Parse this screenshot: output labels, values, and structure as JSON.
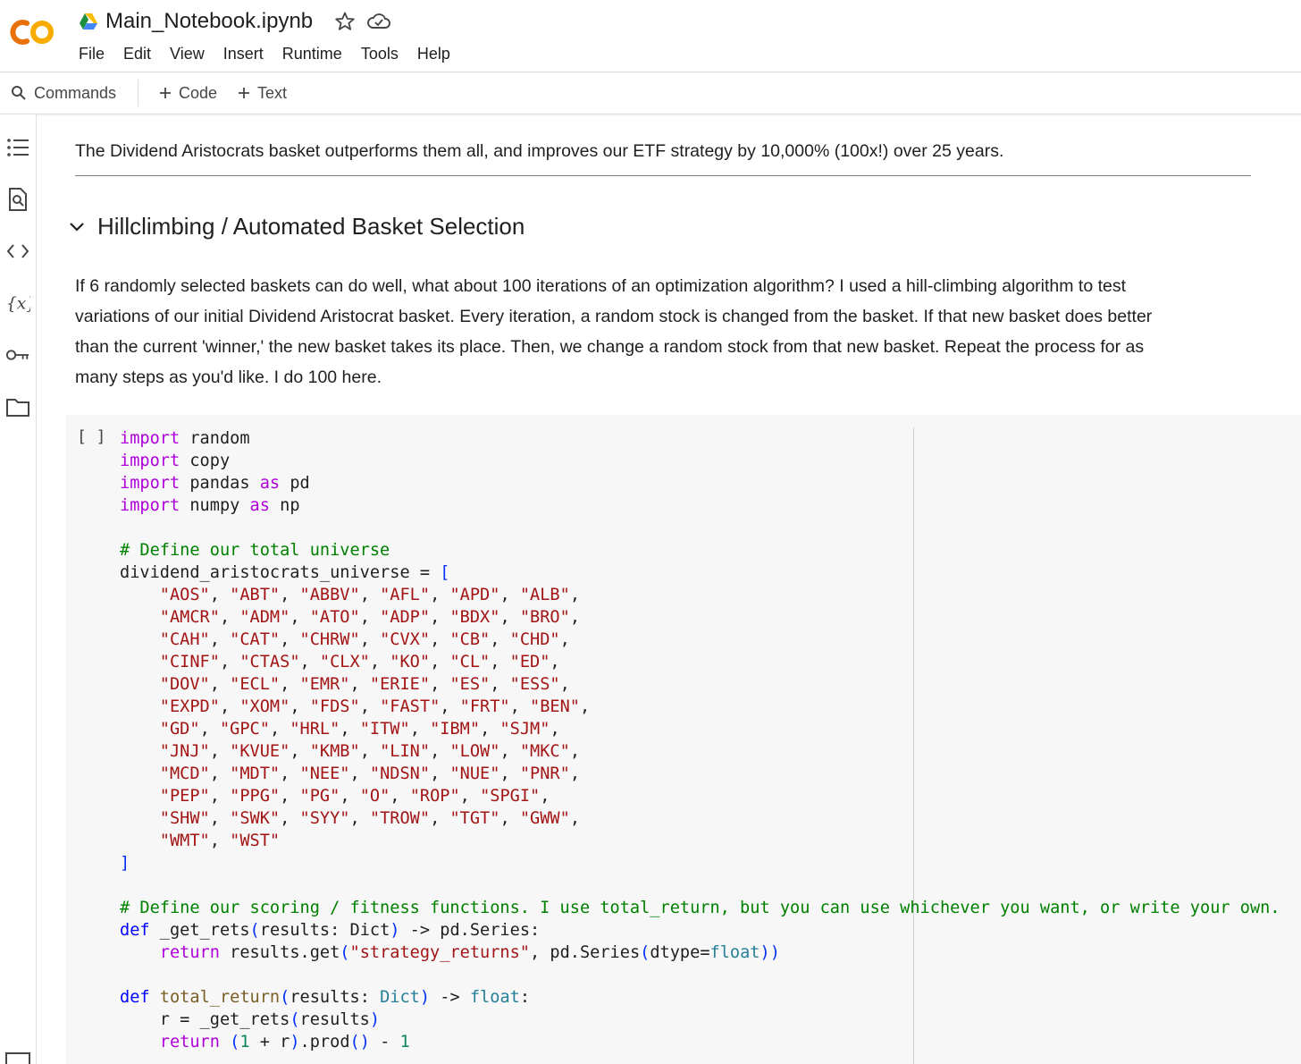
{
  "header": {
    "notebook_title": "Main_Notebook.ipynb",
    "logo_text": "CO",
    "colors": {
      "logo_orange": "#f9ab00",
      "logo_dark_orange": "#e8710a"
    }
  },
  "menu": {
    "items": [
      "File",
      "Edit",
      "View",
      "Insert",
      "Runtime",
      "Tools",
      "Help"
    ]
  },
  "toolbar": {
    "commands_label": "Commands",
    "code_label": "Code",
    "text_label": "Text"
  },
  "sidebar": {
    "icons": [
      "table-of-contents-icon",
      "find-icon",
      "code-snippets-icon",
      "variables-icon",
      "secrets-key-icon",
      "files-folder-icon",
      "terminal-icon"
    ]
  },
  "cells": {
    "text1": "The Dividend Aristocrats basket outperforms them all, and improves our ETF strategy by 10,000% (100x!) over 25 years.",
    "heading": "Hillclimbing / Automated Basket Selection",
    "para": [
      "If 6 randomly selected baskets can do well, what about 100 iterations of an optimization algorithm? I used a hill-climbing algorithm to test",
      "variations of our initial Dividend Aristocrat basket. Every iteration, a random stock is changed from the basket. If that new basket does better",
      "than the current 'winner,' the new basket takes its place. Then, we change a random stock from that new basket. Repeat the process for as",
      "many steps as you'd like. I do 100 here."
    ],
    "code_cell": {
      "execution_count": "[ ]",
      "lines": [
        [
          [
            "kw",
            "import"
          ],
          [
            "p",
            " random"
          ]
        ],
        [
          [
            "kw",
            "import"
          ],
          [
            "p",
            " copy"
          ]
        ],
        [
          [
            "kw",
            "import"
          ],
          [
            "p",
            " pandas "
          ],
          [
            "kw",
            "as"
          ],
          [
            "p",
            " pd"
          ]
        ],
        [
          [
            "kw",
            "import"
          ],
          [
            "p",
            " numpy "
          ],
          [
            "kw",
            "as"
          ],
          [
            "p",
            " np"
          ]
        ],
        [],
        [
          [
            "cm",
            "# Define our total universe"
          ]
        ],
        [
          [
            "p",
            "dividend_aristocrats_universe = "
          ],
          [
            "bk",
            "["
          ]
        ],
        [
          [
            "p",
            "    "
          ],
          [
            "st",
            "\"AOS\""
          ],
          [
            "p",
            ", "
          ],
          [
            "st",
            "\"ABT\""
          ],
          [
            "p",
            ", "
          ],
          [
            "st",
            "\"ABBV\""
          ],
          [
            "p",
            ", "
          ],
          [
            "st",
            "\"AFL\""
          ],
          [
            "p",
            ", "
          ],
          [
            "st",
            "\"APD\""
          ],
          [
            "p",
            ", "
          ],
          [
            "st",
            "\"ALB\""
          ],
          [
            "p",
            ","
          ]
        ],
        [
          [
            "p",
            "    "
          ],
          [
            "st",
            "\"AMCR\""
          ],
          [
            "p",
            ", "
          ],
          [
            "st",
            "\"ADM\""
          ],
          [
            "p",
            ", "
          ],
          [
            "st",
            "\"ATO\""
          ],
          [
            "p",
            ", "
          ],
          [
            "st",
            "\"ADP\""
          ],
          [
            "p",
            ", "
          ],
          [
            "st",
            "\"BDX\""
          ],
          [
            "p",
            ", "
          ],
          [
            "st",
            "\"BRO\""
          ],
          [
            "p",
            ","
          ]
        ],
        [
          [
            "p",
            "    "
          ],
          [
            "st",
            "\"CAH\""
          ],
          [
            "p",
            ", "
          ],
          [
            "st",
            "\"CAT\""
          ],
          [
            "p",
            ", "
          ],
          [
            "st",
            "\"CHRW\""
          ],
          [
            "p",
            ", "
          ],
          [
            "st",
            "\"CVX\""
          ],
          [
            "p",
            ", "
          ],
          [
            "st",
            "\"CB\""
          ],
          [
            "p",
            ", "
          ],
          [
            "st",
            "\"CHD\""
          ],
          [
            "p",
            ","
          ]
        ],
        [
          [
            "p",
            "    "
          ],
          [
            "st",
            "\"CINF\""
          ],
          [
            "p",
            ", "
          ],
          [
            "st",
            "\"CTAS\""
          ],
          [
            "p",
            ", "
          ],
          [
            "st",
            "\"CLX\""
          ],
          [
            "p",
            ", "
          ],
          [
            "st",
            "\"KO\""
          ],
          [
            "p",
            ", "
          ],
          [
            "st",
            "\"CL\""
          ],
          [
            "p",
            ", "
          ],
          [
            "st",
            "\"ED\""
          ],
          [
            "p",
            ","
          ]
        ],
        [
          [
            "p",
            "    "
          ],
          [
            "st",
            "\"DOV\""
          ],
          [
            "p",
            ", "
          ],
          [
            "st",
            "\"ECL\""
          ],
          [
            "p",
            ", "
          ],
          [
            "st",
            "\"EMR\""
          ],
          [
            "p",
            ", "
          ],
          [
            "st",
            "\"ERIE\""
          ],
          [
            "p",
            ", "
          ],
          [
            "st",
            "\"ES\""
          ],
          [
            "p",
            ", "
          ],
          [
            "st",
            "\"ESS\""
          ],
          [
            "p",
            ","
          ]
        ],
        [
          [
            "p",
            "    "
          ],
          [
            "st",
            "\"EXPD\""
          ],
          [
            "p",
            ", "
          ],
          [
            "st",
            "\"XOM\""
          ],
          [
            "p",
            ", "
          ],
          [
            "st",
            "\"FDS\""
          ],
          [
            "p",
            ", "
          ],
          [
            "st",
            "\"FAST\""
          ],
          [
            "p",
            ", "
          ],
          [
            "st",
            "\"FRT\""
          ],
          [
            "p",
            ", "
          ],
          [
            "st",
            "\"BEN\""
          ],
          [
            "p",
            ","
          ]
        ],
        [
          [
            "p",
            "    "
          ],
          [
            "st",
            "\"GD\""
          ],
          [
            "p",
            ", "
          ],
          [
            "st",
            "\"GPC\""
          ],
          [
            "p",
            ", "
          ],
          [
            "st",
            "\"HRL\""
          ],
          [
            "p",
            ", "
          ],
          [
            "st",
            "\"ITW\""
          ],
          [
            "p",
            ", "
          ],
          [
            "st",
            "\"IBM\""
          ],
          [
            "p",
            ", "
          ],
          [
            "st",
            "\"SJM\""
          ],
          [
            "p",
            ","
          ]
        ],
        [
          [
            "p",
            "    "
          ],
          [
            "st",
            "\"JNJ\""
          ],
          [
            "p",
            ", "
          ],
          [
            "st",
            "\"KVUE\""
          ],
          [
            "p",
            ", "
          ],
          [
            "st",
            "\"KMB\""
          ],
          [
            "p",
            ", "
          ],
          [
            "st",
            "\"LIN\""
          ],
          [
            "p",
            ", "
          ],
          [
            "st",
            "\"LOW\""
          ],
          [
            "p",
            ", "
          ],
          [
            "st",
            "\"MKC\""
          ],
          [
            "p",
            ","
          ]
        ],
        [
          [
            "p",
            "    "
          ],
          [
            "st",
            "\"MCD\""
          ],
          [
            "p",
            ", "
          ],
          [
            "st",
            "\"MDT\""
          ],
          [
            "p",
            ", "
          ],
          [
            "st",
            "\"NEE\""
          ],
          [
            "p",
            ", "
          ],
          [
            "st",
            "\"NDSN\""
          ],
          [
            "p",
            ", "
          ],
          [
            "st",
            "\"NUE\""
          ],
          [
            "p",
            ", "
          ],
          [
            "st",
            "\"PNR\""
          ],
          [
            "p",
            ","
          ]
        ],
        [
          [
            "p",
            "    "
          ],
          [
            "st",
            "\"PEP\""
          ],
          [
            "p",
            ", "
          ],
          [
            "st",
            "\"PPG\""
          ],
          [
            "p",
            ", "
          ],
          [
            "st",
            "\"PG\""
          ],
          [
            "p",
            ", "
          ],
          [
            "st",
            "\"O\""
          ],
          [
            "p",
            ", "
          ],
          [
            "st",
            "\"ROP\""
          ],
          [
            "p",
            ", "
          ],
          [
            "st",
            "\"SPGI\""
          ],
          [
            "p",
            ","
          ]
        ],
        [
          [
            "p",
            "    "
          ],
          [
            "st",
            "\"SHW\""
          ],
          [
            "p",
            ", "
          ],
          [
            "st",
            "\"SWK\""
          ],
          [
            "p",
            ", "
          ],
          [
            "st",
            "\"SYY\""
          ],
          [
            "p",
            ", "
          ],
          [
            "st",
            "\"TROW\""
          ],
          [
            "p",
            ", "
          ],
          [
            "st",
            "\"TGT\""
          ],
          [
            "p",
            ", "
          ],
          [
            "st",
            "\"GWW\""
          ],
          [
            "p",
            ","
          ]
        ],
        [
          [
            "p",
            "    "
          ],
          [
            "st",
            "\"WMT\""
          ],
          [
            "p",
            ", "
          ],
          [
            "st",
            "\"WST\""
          ]
        ],
        [
          [
            "bk",
            "]"
          ]
        ],
        [],
        [
          [
            "cm",
            "# Define our scoring / fitness functions. I use total_return, but you can use whichever you want, or write your own."
          ]
        ],
        [
          [
            "kb",
            "def"
          ],
          [
            "p",
            " _get_rets"
          ],
          [
            "bk",
            "("
          ],
          [
            "p",
            "results: Dict"
          ],
          [
            "bk",
            ")"
          ],
          [
            "p",
            " -> pd.Series:"
          ]
        ],
        [
          [
            "p",
            "    "
          ],
          [
            "kw",
            "return"
          ],
          [
            "p",
            " results.get"
          ],
          [
            "bk",
            "("
          ],
          [
            "st",
            "\"strategy_returns\""
          ],
          [
            "p",
            ", pd.Series"
          ],
          [
            "bk",
            "("
          ],
          [
            "p",
            "dtype="
          ],
          [
            "ty",
            "float"
          ],
          [
            "bk",
            "))"
          ]
        ],
        [],
        [
          [
            "kb",
            "def"
          ],
          [
            "p",
            " "
          ],
          [
            "fn",
            "total_return"
          ],
          [
            "bk",
            "("
          ],
          [
            "p",
            "results: "
          ],
          [
            "ty",
            "Dict"
          ],
          [
            "bk",
            ")"
          ],
          [
            "p",
            " -> "
          ],
          [
            "ty",
            "float"
          ],
          [
            "p",
            ":"
          ]
        ],
        [
          [
            "p",
            "    r = _get_rets"
          ],
          [
            "bk",
            "("
          ],
          [
            "p",
            "results"
          ],
          [
            "bk",
            ")"
          ]
        ],
        [
          [
            "p",
            "    "
          ],
          [
            "kw",
            "return"
          ],
          [
            "p",
            " "
          ],
          [
            "bk",
            "("
          ],
          [
            "nm",
            "1"
          ],
          [
            "p",
            " + r"
          ],
          [
            "bk",
            ")"
          ],
          [
            "p",
            ".prod"
          ],
          [
            "bk",
            "()"
          ],
          [
            "p",
            " - "
          ],
          [
            "nm",
            "1"
          ]
        ]
      ]
    }
  }
}
